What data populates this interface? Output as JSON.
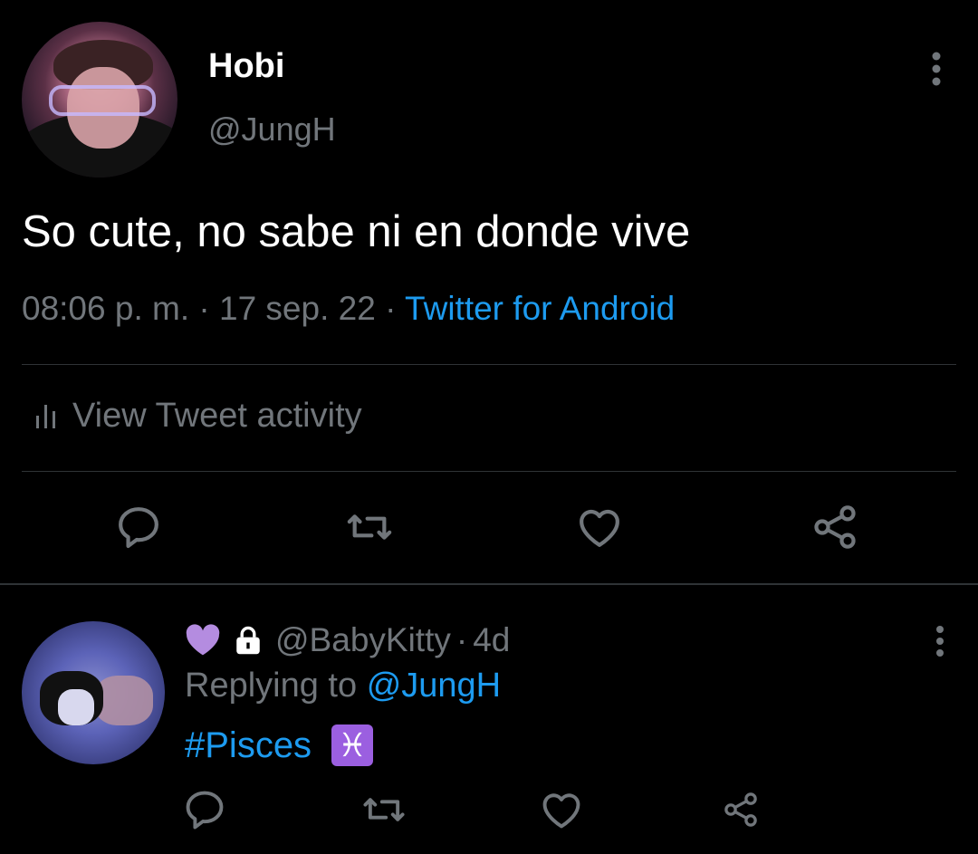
{
  "tweet": {
    "author": {
      "display_name": "Hobi",
      "handle": "@JungH"
    },
    "text": "So cute, no sabe ni en donde vive",
    "time": "08:06 p. m.",
    "separator": "·",
    "date": "17 sep. 22",
    "source": "Twitter for Android",
    "activity_label": "View Tweet activity",
    "actions": [
      "reply-icon",
      "retweet-icon",
      "like-icon",
      "share-icon"
    ]
  },
  "reply": {
    "handle": "@BabyKitty",
    "separator": "·",
    "age": "4d",
    "replying_prefix": "Replying to",
    "replying_to": "@JungH",
    "hashtag": "#Pisces",
    "emoji": "♓",
    "actions": [
      "reply-icon",
      "retweet-icon",
      "like-icon",
      "share-icon"
    ]
  },
  "colors": {
    "background": "#000000",
    "text": "#ffffff",
    "secondary": "#71767b",
    "link": "#1d9bf0",
    "divider": "#2f3336",
    "heart_badge": "#b48ce0"
  }
}
